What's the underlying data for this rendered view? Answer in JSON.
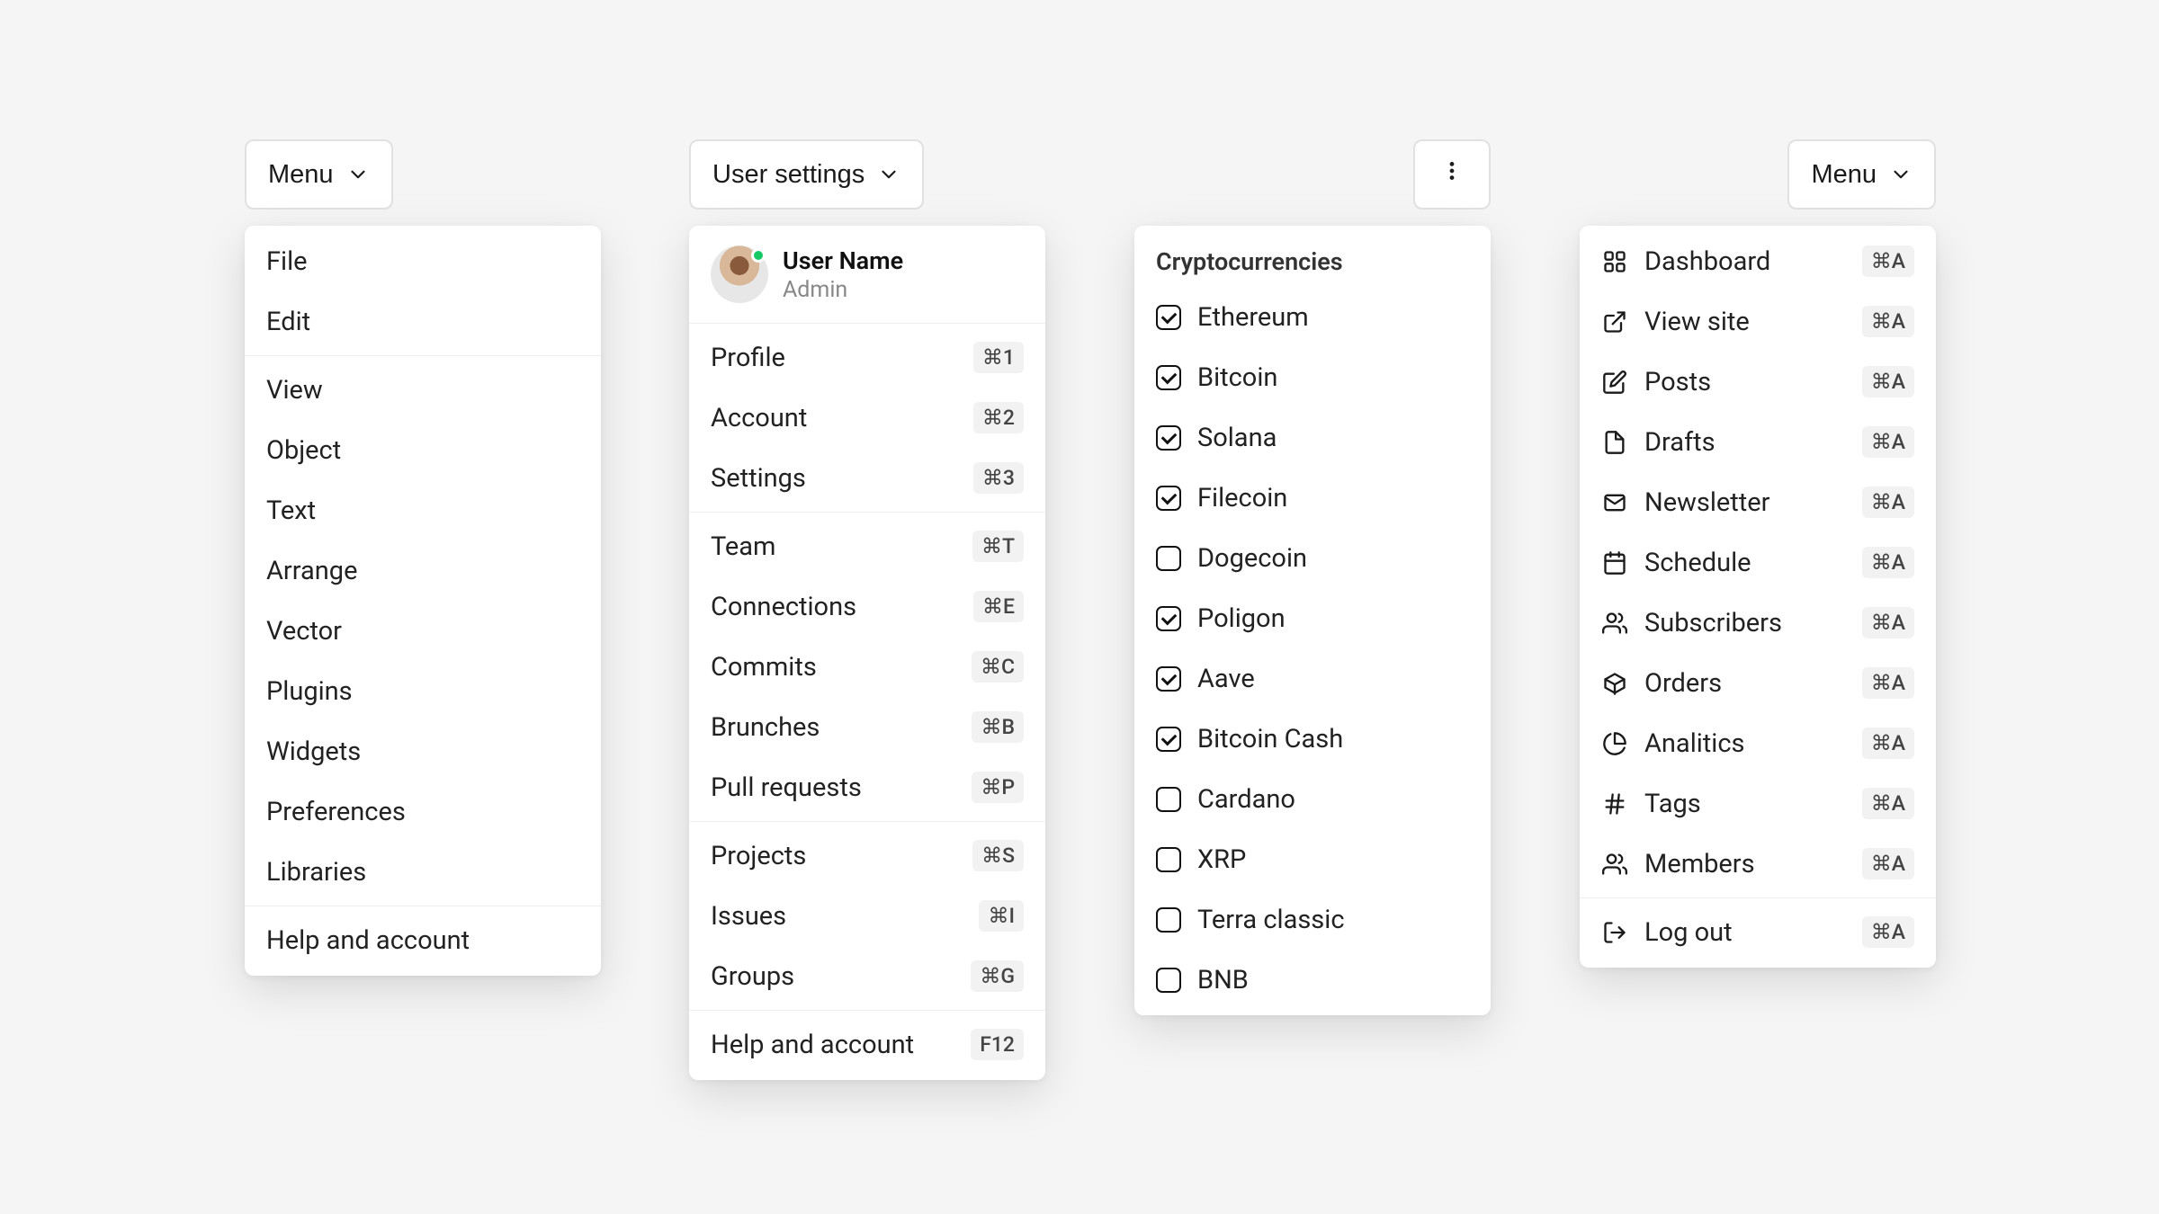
{
  "menu1": {
    "button_label": "Menu",
    "items": [
      {
        "label": "File"
      },
      {
        "label": "Edit"
      },
      {
        "divider": true
      },
      {
        "label": "View"
      },
      {
        "label": "Object"
      },
      {
        "label": "Text"
      },
      {
        "label": "Arrange"
      },
      {
        "label": "Vector"
      },
      {
        "label": "Plugins"
      },
      {
        "label": "Widgets"
      },
      {
        "label": "Preferences"
      },
      {
        "label": "Libraries"
      },
      {
        "divider": true
      },
      {
        "label": "Help and account"
      }
    ]
  },
  "menu2": {
    "button_label": "User settings",
    "user": {
      "name": "User Name",
      "role": "Admin"
    },
    "items": [
      {
        "label": "Profile",
        "shortcut": "⌘1"
      },
      {
        "label": "Account",
        "shortcut": "⌘2"
      },
      {
        "label": "Settings",
        "shortcut": "⌘3"
      },
      {
        "divider": true
      },
      {
        "label": "Team",
        "shortcut": "⌘T"
      },
      {
        "label": "Connections",
        "shortcut": "⌘E"
      },
      {
        "label": "Commits",
        "shortcut": "⌘C"
      },
      {
        "label": "Brunches",
        "shortcut": "⌘B"
      },
      {
        "label": "Pull requests",
        "shortcut": "⌘P"
      },
      {
        "divider": true
      },
      {
        "label": "Projects",
        "shortcut": "⌘S"
      },
      {
        "label": "Issues",
        "shortcut": "⌘I"
      },
      {
        "label": "Groups",
        "shortcut": "⌘G"
      },
      {
        "divider": true
      },
      {
        "label": "Help and account",
        "shortcut": "F12"
      }
    ]
  },
  "menu3": {
    "header": "Cryptocurrencies",
    "items": [
      {
        "label": "Ethereum",
        "checked": true
      },
      {
        "label": "Bitcoin",
        "checked": true
      },
      {
        "label": "Solana",
        "checked": true
      },
      {
        "label": "Filecoin",
        "checked": true
      },
      {
        "label": "Dogecoin",
        "checked": false
      },
      {
        "label": "Poligon",
        "checked": true
      },
      {
        "label": "Aave",
        "checked": true
      },
      {
        "label": "Bitcoin Cash",
        "checked": true
      },
      {
        "label": "Cardano",
        "checked": false
      },
      {
        "label": "XRP",
        "checked": false
      },
      {
        "label": "Terra classic",
        "checked": false
      },
      {
        "label": "BNB",
        "checked": false
      }
    ]
  },
  "menu4": {
    "button_label": "Menu",
    "items": [
      {
        "label": "Dashboard",
        "icon": "grid-icon",
        "shortcut": "⌘A"
      },
      {
        "label": "View site",
        "icon": "external-link-icon",
        "shortcut": "⌘A"
      },
      {
        "label": "Posts",
        "icon": "edit-icon",
        "shortcut": "⌘A"
      },
      {
        "label": "Drafts",
        "icon": "file-icon",
        "shortcut": "⌘A"
      },
      {
        "label": "Newsletter",
        "icon": "mail-icon",
        "shortcut": "⌘A"
      },
      {
        "label": "Schedule",
        "icon": "calendar-icon",
        "shortcut": "⌘A"
      },
      {
        "label": "Subscribers",
        "icon": "users-icon",
        "shortcut": "⌘A"
      },
      {
        "label": "Orders",
        "icon": "package-icon",
        "shortcut": "⌘A"
      },
      {
        "label": "Analitics",
        "icon": "pie-chart-icon",
        "shortcut": "⌘A"
      },
      {
        "label": "Tags",
        "icon": "hash-icon",
        "shortcut": "⌘A"
      },
      {
        "label": "Members",
        "icon": "users-icon",
        "shortcut": "⌘A"
      },
      {
        "divider": true
      },
      {
        "label": "Log out",
        "icon": "logout-icon",
        "shortcut": "⌘A"
      }
    ]
  }
}
